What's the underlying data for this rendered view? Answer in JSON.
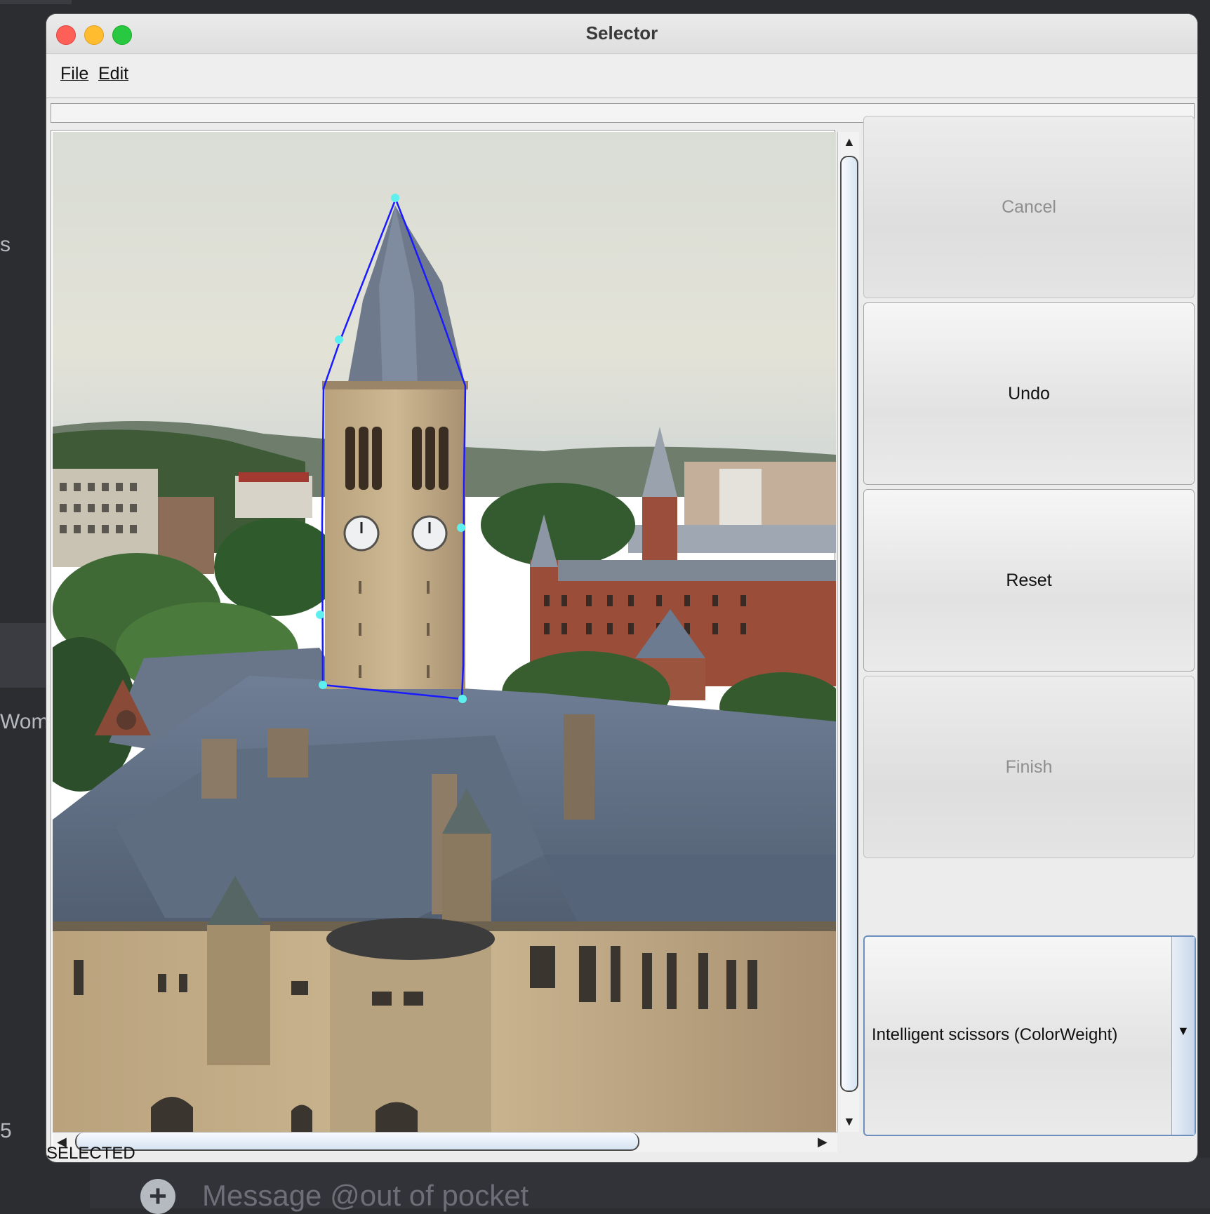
{
  "background_app": {
    "fragments": [
      "s",
      "Wom.",
      "5"
    ],
    "message_placeholder": "Message @out of pocket"
  },
  "window": {
    "title": "Selector",
    "menu": [
      "File",
      "Edit"
    ],
    "status": "SELECTED"
  },
  "buttons": {
    "cancel": "Cancel",
    "undo": "Undo",
    "reset": "Reset",
    "finish": "Finish"
  },
  "tool_select": {
    "selected": "Intelligent scissors (ColorWeight)"
  },
  "colors": {
    "selection_path": "#1a1aff",
    "control_points": "#5ef0ee"
  }
}
